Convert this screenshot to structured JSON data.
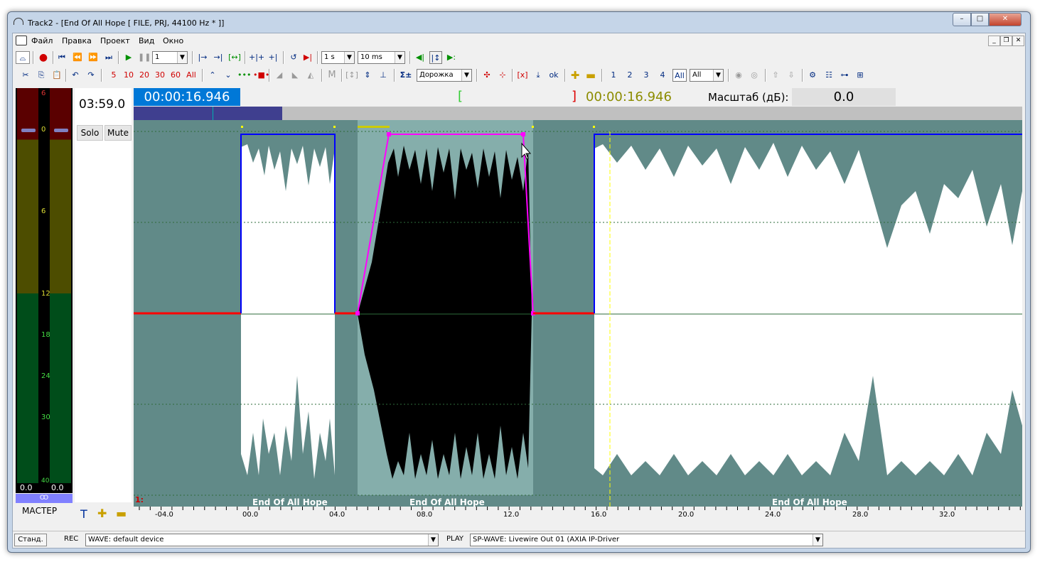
{
  "window": {
    "title": "Track2 - [End Of All Hope [ FILE, PRJ, 44100 Hz * ]]",
    "minimize": "–",
    "maximize": "□",
    "close": "✕"
  },
  "menu": {
    "items": [
      "Файл",
      "Правка",
      "Проект",
      "Вид",
      "Окно"
    ],
    "mdi_buttons": [
      "_",
      "❐",
      "✕"
    ]
  },
  "toolbar1": {
    "record_count": "1",
    "step_time": "1 s",
    "step_ms": "10 ms"
  },
  "toolbar2": {
    "zoom_values": [
      "5",
      "10",
      "20",
      "30",
      "60",
      "All"
    ],
    "mode_label": "M",
    "sigma_label": "Σ±",
    "track_mode": "Дорожка",
    "track_numbers": [
      "1",
      "2",
      "3",
      "4",
      "All"
    ],
    "track_select": "All",
    "ok_label": "ok"
  },
  "meter": {
    "labels": [
      "6",
      "0",
      "6",
      "12",
      "18",
      "24",
      "30",
      "40"
    ],
    "left_value": "0.0",
    "right_value": "0.0",
    "mono_label": "Ꝏ",
    "master_label": "МАСТЕР"
  },
  "track": {
    "length": "03:59.0",
    "solo": "Solo",
    "mute": "Mute",
    "number": "1:"
  },
  "header": {
    "position": "00:00:16.946",
    "bracket_left": "[",
    "bracket_right": "]",
    "selection_time": "00:00:16.946",
    "scale_label": "Масштаб (дБ):",
    "scale_value": "0.0"
  },
  "clips": [
    {
      "name": "End Of All Hope"
    },
    {
      "name": "End Of All Hope"
    },
    {
      "name": "End Of All Hope"
    }
  ],
  "ruler": {
    "labels": [
      "-04.0",
      "00.0",
      "04.0",
      "08.0",
      "12.0",
      "16.0",
      "20.0",
      "24.0",
      "28.0",
      "32.0"
    ]
  },
  "status": {
    "mode": "Станд.",
    "rec_label": "REC",
    "rec_device": "WAVE: default device",
    "play_label": "PLAY",
    "play_device": "SP-WAVE: Livewire Out 01 (AXIA IP-Driver"
  },
  "colors": {
    "wave_bg": "#618a88",
    "envelope_blue": "#0000ff",
    "envelope_magenta": "#ff00ff",
    "envelope_red": "#ff0000",
    "position_chip": "#0078d7",
    "cursor": "#ffff00"
  }
}
